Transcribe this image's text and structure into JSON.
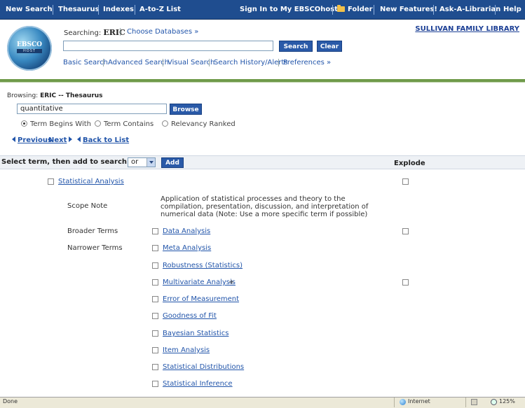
{
  "topnav": {
    "new_search": "New Search",
    "thesaurus": "Thesaurus",
    "indexes": "Indexes",
    "atoz": "A-to-Z List",
    "sign_in": "Sign In to My EBSCOhost",
    "folder": "Folder",
    "new_features": "New Features!",
    "ask": "Ask-A-Librarian",
    "help": "Help"
  },
  "header": {
    "logo_top": "EBSCO",
    "logo_bottom": "HOST",
    "searching_label": "Searching:",
    "database": "ERIC",
    "choose_databases": "Choose Databases »",
    "library": "SULLIVAN FAMILY LIBRARY",
    "search_placeholder": "",
    "search_button": "Search",
    "clear_button": "Clear",
    "links": {
      "basic": "Basic Search",
      "advanced": "Advanced Search",
      "visual": "Visual Search",
      "history": "Search History/Alerts",
      "preferences": "Preferences »"
    }
  },
  "browse": {
    "browsing_label": "Browsing:",
    "browsing_value": "ERIC -- Thesaurus",
    "term": "quantitative",
    "browse_button": "Browse",
    "options": {
      "begins": "Term Begins With",
      "contains": "Term Contains",
      "relevancy": "Relevancy Ranked"
    },
    "previous": "Previous",
    "next": "Next",
    "back": "Back to List"
  },
  "selectbar": {
    "label": "Select term, then add to search using:",
    "operator": "or",
    "add_button": "Add",
    "explode": "Explode"
  },
  "entry": {
    "term": "Statistical Analysis",
    "scope_label": "Scope Note",
    "scope_text": "Application of statistical processes and theory to the compilation, presentation, discussion, and interpretation of numerical data (Note: Use a more specific term if possible)",
    "broader_label": "Broader Terms",
    "broader": [
      "Data Analysis"
    ],
    "narrower_label": "Narrower Terms",
    "narrower": [
      "Meta Analysis",
      "Robustness (Statistics)",
      "Multivariate Analysis",
      "Error of Measurement",
      "Goodness of Fit",
      "Bayesian Statistics",
      "Item Analysis",
      "Statistical Distributions",
      "Statistical Inference"
    ],
    "plus_marker": "+"
  },
  "statusbar": {
    "status": "Done",
    "zone": "Internet",
    "zoom": "125%"
  },
  "colors": {
    "nav_bg": "#1f4d8f",
    "link": "#2255aa",
    "accent_green": "#6f9a4a",
    "button": "#2a5aa8"
  }
}
